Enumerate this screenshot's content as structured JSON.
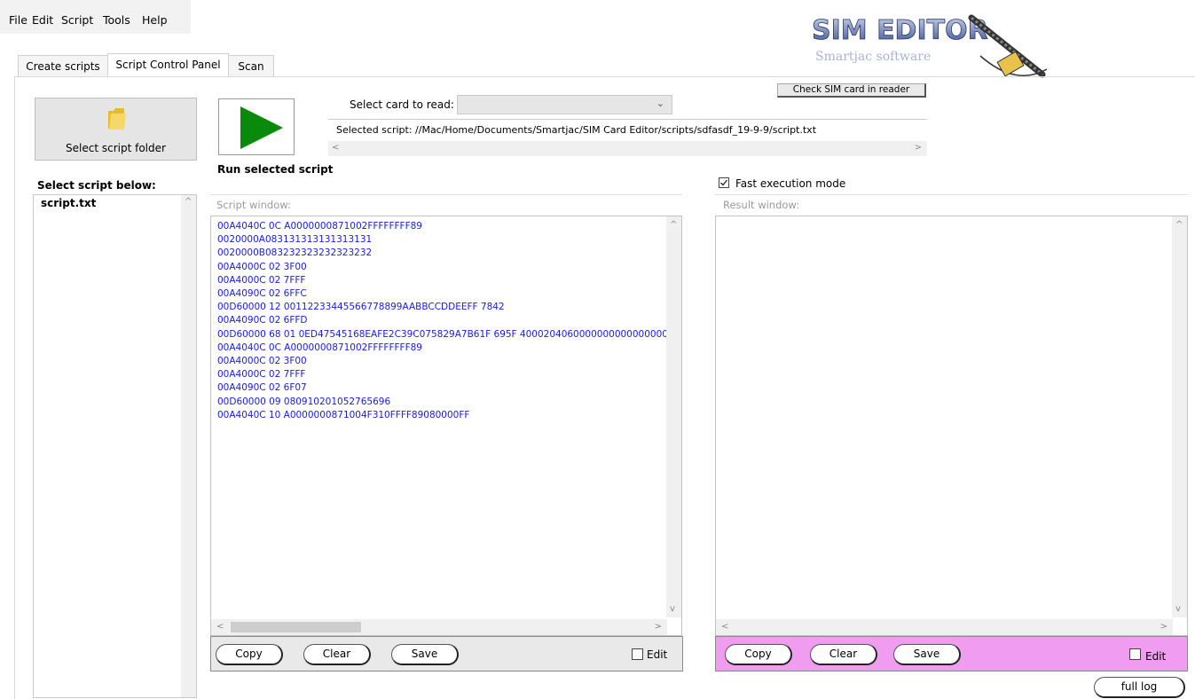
{
  "menu": [
    "File",
    "Edit",
    "Script",
    "Tools",
    "Help"
  ],
  "tabs": [
    {
      "label": "Create scripts",
      "active": false
    },
    {
      "label": "Script Control Panel",
      "active": true
    },
    {
      "label": "Scan",
      "active": false
    }
  ],
  "logo": {
    "title": "SIM EDITOR",
    "subtitle": "Smartjac software"
  },
  "folder_button": {
    "label": "Select script folder"
  },
  "run_button": {
    "label": "Run selected script"
  },
  "card_select": {
    "label": "Select card to read:",
    "value": ""
  },
  "check_sim_button": {
    "label": "Check SIM card in reader"
  },
  "selected_script": "Selected script: //Mac/Home/Documents/Smartjac/SIM Card Editor/scripts/sdfasdf_19-9-9/script.txt",
  "script_list": {
    "heading": "Select script below:",
    "items": [
      "script.txt"
    ]
  },
  "fast_mode": {
    "label": "Fast execution mode",
    "checked": true
  },
  "script_window": {
    "label": "Script window:",
    "text": "00A4040C 0C A0000000871002FFFFFFFF89\n0020000A083131313131313131\n0020000B083232323232323232\n00A4000C 02 3F00\n00A4000C 02 7FFF\n00A4090C 02 6FFC\n00D60000 12 00112233445566778899AABBCCDDEEFF 7842\n00A4090C 02 6FFD\n00D60000 68 01 0ED47545168EAFE2C39C075829A7B61F 695F 40002040600000000000000000\n00A4040C 0C A0000000871002FFFFFFFF89\n00A4000C 02 3F00\n00A4000C 02 7FFF\n00A4090C 02 6F07\n00D60000 09 080910201052765696\n00A4040C 10 A0000000871004F310FFFF89080000FF"
  },
  "result_window": {
    "label": "Result window:",
    "text": ""
  },
  "script_toolbar": {
    "copy": "Copy",
    "clear": "Clear",
    "save": "Save",
    "edit": "Edit",
    "edit_checked": false
  },
  "result_toolbar": {
    "copy": "Copy",
    "clear": "Clear",
    "save": "Save",
    "edit": "Edit",
    "edit_checked": false,
    "background": "#f09cf0"
  },
  "full_log_button": "full log"
}
